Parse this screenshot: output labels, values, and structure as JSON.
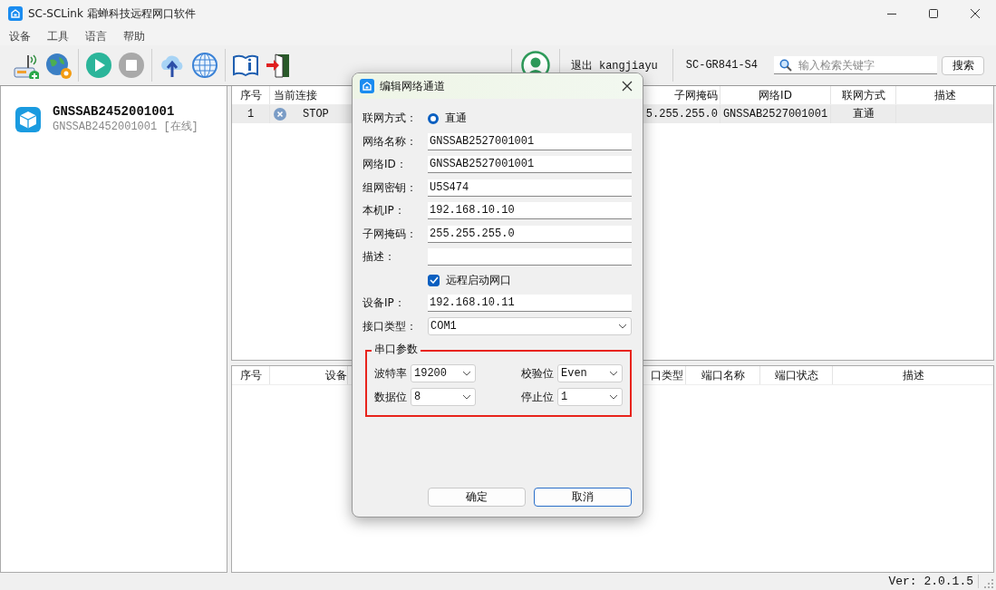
{
  "window": {
    "title": "SC-SCLink 霜蝉科技远程网口软件"
  },
  "menu": [
    "设备",
    "工具",
    "语言",
    "帮助"
  ],
  "toolbar": {
    "user": "退出 kangjiayu",
    "device": "SC-GR841-S4",
    "search": {
      "placeholder": "输入检索关键字"
    },
    "search_button": "搜索"
  },
  "devices": [
    {
      "name": "GNSSAB2452001001",
      "subtitle": "GNSSAB2452001001 [在线]"
    }
  ],
  "channels_table": {
    "columns": [
      "序号",
      "当前连接",
      "子网掩码",
      "网络ID",
      "联网方式",
      "描述"
    ],
    "rows": [
      {
        "cells": [
          "1",
          "STOP",
          "5.255.255.0",
          "GNSSAB2527001001",
          "直通"
        ]
      }
    ]
  },
  "ports_table": {
    "columns": [
      "序号",
      "设备",
      "口类型",
      "端口名称",
      "端口状态",
      "描述"
    ]
  },
  "status_bar": {
    "version": "Ver: 2.0.1.5"
  },
  "dialog": {
    "title": "编辑网络通道",
    "rows": [
      {
        "kind": "radio",
        "label": "联网方式：",
        "option": "直通",
        "selected": true
      },
      {
        "kind": "text",
        "label": "网络名称：",
        "value": "GNSSAB2527001001"
      },
      {
        "kind": "text",
        "label": "网络ID：",
        "value": "GNSSAB2527001001"
      },
      {
        "kind": "text",
        "label": "组网密钥：",
        "value": "U5S474"
      },
      {
        "kind": "text",
        "label": "本机IP：",
        "value": "192.168.10.10"
      },
      {
        "kind": "text",
        "label": "子网掩码：",
        "value": "255.255.255.0"
      },
      {
        "kind": "text",
        "label": "描述："
      },
      {
        "kind": "checkbox",
        "option": "远程启动网口",
        "checked": true
      },
      {
        "kind": "text",
        "label": "设备IP：",
        "value": "192.168.10.11"
      },
      {
        "kind": "select",
        "label": "接口类型：",
        "value": "COM1"
      }
    ],
    "serial": {
      "title": "串口参数",
      "fields": [
        {
          "label": "波特率",
          "value": "19200"
        },
        {
          "label": "校验位",
          "value": "Even"
        },
        {
          "label": "数据位",
          "value": "8"
        },
        {
          "label": "停止位",
          "value": "1"
        }
      ]
    },
    "buttons": [
      {
        "label": "确定",
        "focused": false
      },
      {
        "label": "取消",
        "focused": true
      }
    ]
  }
}
